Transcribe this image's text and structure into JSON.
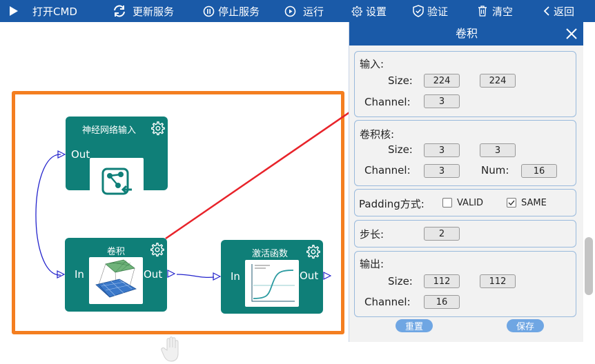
{
  "toolbar": {
    "open_cmd": "打开CMD",
    "refresh": "更新服务",
    "stop": "停止服务",
    "run": "运行",
    "settings": "设置",
    "verify": "验证",
    "clear": "清空",
    "back": "返回"
  },
  "nodes": {
    "input_node": {
      "title": "神经网络输入",
      "out": "Out"
    },
    "conv_node": {
      "title": "卷积",
      "in": "In",
      "out": "Out"
    },
    "act_node": {
      "title": "激活函数",
      "in": "In",
      "out": "Out"
    }
  },
  "panel": {
    "title": "卷积",
    "input": {
      "heading": "输入:",
      "size_label": "Size:",
      "size_w": "224",
      "size_h": "224",
      "channel_label": "Channel:",
      "channel": "3"
    },
    "kernel": {
      "heading": "卷积核:",
      "size_label": "Size:",
      "size_w": "3",
      "size_h": "3",
      "channel_label": "Channel:",
      "channel": "3",
      "num_label": "Num:",
      "num": "16"
    },
    "padding": {
      "label": "Padding方式:",
      "valid": "VALID",
      "valid_checked": false,
      "same": "SAME",
      "same_checked": true
    },
    "stride": {
      "label": "步长:",
      "value": "2"
    },
    "output": {
      "heading": "输出:",
      "size_label": "Size:",
      "size_w": "112",
      "size_h": "112",
      "channel_label": "Channel:",
      "channel": "16"
    },
    "reset_label": "重置",
    "save_label": "保存"
  },
  "colors": {
    "toolbar": "#1a5aa8",
    "node": "#0f7f78",
    "selection": "#f47e20",
    "link": "#2222cc",
    "arrow": "#e8232a",
    "button": "#6fa6e3"
  }
}
